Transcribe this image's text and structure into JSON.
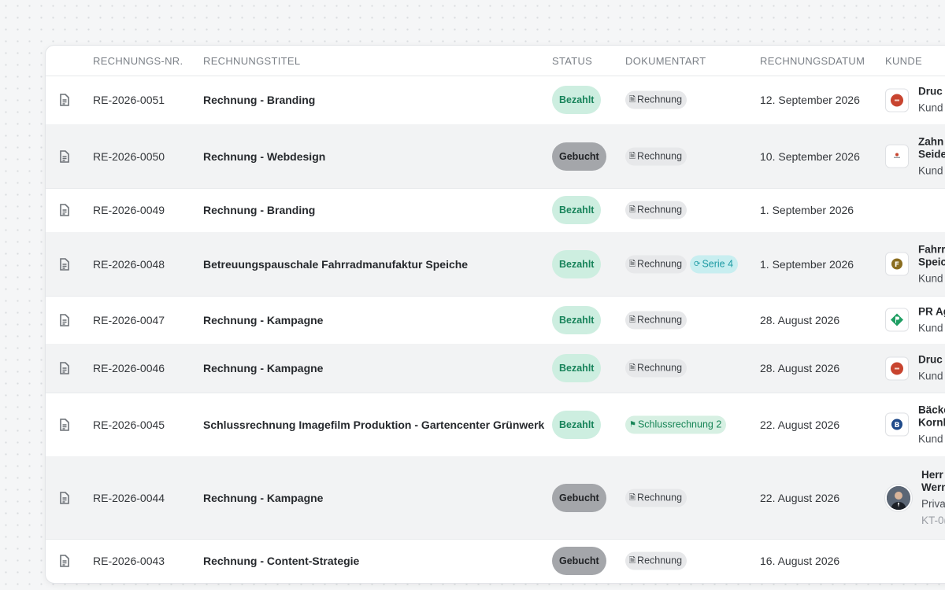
{
  "columns": {
    "number": "RECHNUNGS-NR.",
    "title": "RECHNUNGSTITEL",
    "status": "STATUS",
    "doctype": "DOKUMENTART",
    "date": "RECHNUNGSDATUM",
    "customer": "KUNDE"
  },
  "rows": [
    {
      "number": "RE-2026-0051",
      "title": "Rechnung - Branding",
      "status": "Bezahlt",
      "doctype": "Rechnung",
      "date": "12. September 2026",
      "customer": {
        "line1": "Druc",
        "line2": "Kund"
      }
    },
    {
      "number": "RE-2026-0050",
      "title": "Rechnung - Webdesign",
      "status": "Gebucht",
      "doctype": "Rechnung",
      "date": "10. September 2026",
      "customer": {
        "line1": "Zahn",
        "line2": "Seide",
        "line3": "Kund"
      }
    },
    {
      "number": "RE-2026-0049",
      "title": "Rechnung - Branding",
      "status": "Bezahlt",
      "doctype": "Rechnung",
      "date": "1. September 2026"
    },
    {
      "number": "RE-2026-0048",
      "title": "Betreuungspauschale Fahrradmanufaktur Speiche",
      "status": "Bezahlt",
      "doctype": "Rechnung",
      "extra_tag": "Serie 4",
      "date": "1. September 2026",
      "customer": {
        "line1": "Fahrr",
        "line2": "Speic",
        "line3": "Kund",
        "logo_letter": "F"
      }
    },
    {
      "number": "RE-2026-0047",
      "title": "Rechnung - Kampagne",
      "status": "Bezahlt",
      "doctype": "Rechnung",
      "date": "28. August 2026",
      "customer": {
        "line1": "PR Ag",
        "line2": "Kund"
      }
    },
    {
      "number": "RE-2026-0046",
      "title": "Rechnung - Kampagne",
      "status": "Bezahlt",
      "doctype": "Rechnung",
      "date": "28. August 2026",
      "customer": {
        "line1": "Druc",
        "line2": "Kund"
      }
    },
    {
      "number": "RE-2026-0045",
      "title": "Schlussrechnung Imagefilm Produktion - Gartencenter Grünwerk",
      "status": "Bezahlt",
      "doctype": "Schlussrechnung 2",
      "date": "22. August 2026",
      "customer": {
        "line1": "Bäcke",
        "line2": "Kornl",
        "line3": "Kund",
        "logo_letter": "B"
      }
    },
    {
      "number": "RE-2026-0044",
      "title": "Rechnung - Kampagne",
      "status": "Gebucht",
      "doctype": "Rechnung",
      "date": "22. August 2026",
      "customer": {
        "line1": "Herr",
        "line2": "Wern",
        "line3": "Privat",
        "line4": "KT-0("
      }
    },
    {
      "number": "RE-2026-0043",
      "title": "Rechnung - Content-Strategie",
      "status": "Gebucht",
      "doctype": "Rechnung",
      "date": "16. August 2026"
    }
  ],
  "colors": {
    "paid_bg": "#cdeee0",
    "paid_text": "#17835a",
    "booked_bg": "#a4a6aa",
    "serie_bg": "#c8eef0",
    "final_bg": "#d7f0e3"
  },
  "icons": {
    "row_icon": "document-icon",
    "doctype_icon": "document-small-icon",
    "serie_icon": "repeat-icon",
    "final_icon": "flag-icon"
  }
}
